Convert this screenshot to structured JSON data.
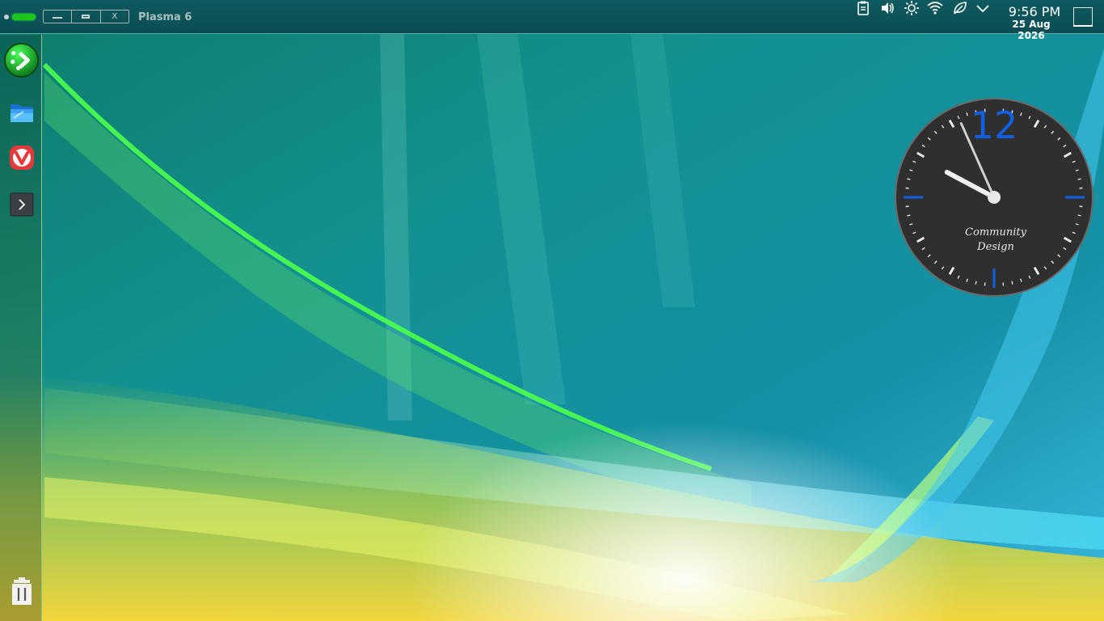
{
  "panel": {
    "app_title": "Plasma 6",
    "window_controls": {
      "minimize_label": "",
      "maximize_label": "",
      "close_label": "X"
    },
    "tray_icons": [
      "clipboard-icon",
      "volume-icon",
      "brightness-icon",
      "wifi-icon",
      "power-saving-leaf-icon",
      "chevron-down-icon"
    ],
    "clock_time": "9:56 PM",
    "clock_date": "25 Aug 2026"
  },
  "dock": {
    "items": [
      "launcher-icon",
      "file-manager-icon",
      "vivaldi-browser-icon",
      "terminal-icon",
      "trash-icon"
    ]
  },
  "clock_widget": {
    "twelve_label": "12",
    "brand_line1": "Community",
    "brand_line2": "Design",
    "hour": 9,
    "minute": 56,
    "accent_color": "#1060e0",
    "face_color": "#333333"
  }
}
